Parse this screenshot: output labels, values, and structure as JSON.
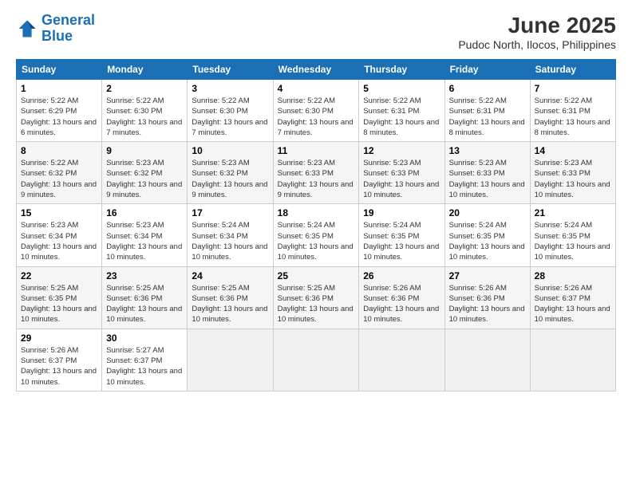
{
  "header": {
    "logo_line1": "General",
    "logo_line2": "Blue",
    "title": "June 2025",
    "subtitle": "Pudoc North, Ilocos, Philippines"
  },
  "weekdays": [
    "Sunday",
    "Monday",
    "Tuesday",
    "Wednesday",
    "Thursday",
    "Friday",
    "Saturday"
  ],
  "weeks": [
    [
      {
        "day": "1",
        "sunrise": "5:22 AM",
        "sunset": "6:29 PM",
        "daylight": "13 hours and 6 minutes."
      },
      {
        "day": "2",
        "sunrise": "5:22 AM",
        "sunset": "6:30 PM",
        "daylight": "13 hours and 7 minutes."
      },
      {
        "day": "3",
        "sunrise": "5:22 AM",
        "sunset": "6:30 PM",
        "daylight": "13 hours and 7 minutes."
      },
      {
        "day": "4",
        "sunrise": "5:22 AM",
        "sunset": "6:30 PM",
        "daylight": "13 hours and 7 minutes."
      },
      {
        "day": "5",
        "sunrise": "5:22 AM",
        "sunset": "6:31 PM",
        "daylight": "13 hours and 8 minutes."
      },
      {
        "day": "6",
        "sunrise": "5:22 AM",
        "sunset": "6:31 PM",
        "daylight": "13 hours and 8 minutes."
      },
      {
        "day": "7",
        "sunrise": "5:22 AM",
        "sunset": "6:31 PM",
        "daylight": "13 hours and 8 minutes."
      }
    ],
    [
      {
        "day": "8",
        "sunrise": "5:22 AM",
        "sunset": "6:32 PM",
        "daylight": "13 hours and 9 minutes."
      },
      {
        "day": "9",
        "sunrise": "5:23 AM",
        "sunset": "6:32 PM",
        "daylight": "13 hours and 9 minutes."
      },
      {
        "day": "10",
        "sunrise": "5:23 AM",
        "sunset": "6:32 PM",
        "daylight": "13 hours and 9 minutes."
      },
      {
        "day": "11",
        "sunrise": "5:23 AM",
        "sunset": "6:33 PM",
        "daylight": "13 hours and 9 minutes."
      },
      {
        "day": "12",
        "sunrise": "5:23 AM",
        "sunset": "6:33 PM",
        "daylight": "13 hours and 10 minutes."
      },
      {
        "day": "13",
        "sunrise": "5:23 AM",
        "sunset": "6:33 PM",
        "daylight": "13 hours and 10 minutes."
      },
      {
        "day": "14",
        "sunrise": "5:23 AM",
        "sunset": "6:33 PM",
        "daylight": "13 hours and 10 minutes."
      }
    ],
    [
      {
        "day": "15",
        "sunrise": "5:23 AM",
        "sunset": "6:34 PM",
        "daylight": "13 hours and 10 minutes."
      },
      {
        "day": "16",
        "sunrise": "5:23 AM",
        "sunset": "6:34 PM",
        "daylight": "13 hours and 10 minutes."
      },
      {
        "day": "17",
        "sunrise": "5:24 AM",
        "sunset": "6:34 PM",
        "daylight": "13 hours and 10 minutes."
      },
      {
        "day": "18",
        "sunrise": "5:24 AM",
        "sunset": "6:35 PM",
        "daylight": "13 hours and 10 minutes."
      },
      {
        "day": "19",
        "sunrise": "5:24 AM",
        "sunset": "6:35 PM",
        "daylight": "13 hours and 10 minutes."
      },
      {
        "day": "20",
        "sunrise": "5:24 AM",
        "sunset": "6:35 PM",
        "daylight": "13 hours and 10 minutes."
      },
      {
        "day": "21",
        "sunrise": "5:24 AM",
        "sunset": "6:35 PM",
        "daylight": "13 hours and 10 minutes."
      }
    ],
    [
      {
        "day": "22",
        "sunrise": "5:25 AM",
        "sunset": "6:35 PM",
        "daylight": "13 hours and 10 minutes."
      },
      {
        "day": "23",
        "sunrise": "5:25 AM",
        "sunset": "6:36 PM",
        "daylight": "13 hours and 10 minutes."
      },
      {
        "day": "24",
        "sunrise": "5:25 AM",
        "sunset": "6:36 PM",
        "daylight": "13 hours and 10 minutes."
      },
      {
        "day": "25",
        "sunrise": "5:25 AM",
        "sunset": "6:36 PM",
        "daylight": "13 hours and 10 minutes."
      },
      {
        "day": "26",
        "sunrise": "5:26 AM",
        "sunset": "6:36 PM",
        "daylight": "13 hours and 10 minutes."
      },
      {
        "day": "27",
        "sunrise": "5:26 AM",
        "sunset": "6:36 PM",
        "daylight": "13 hours and 10 minutes."
      },
      {
        "day": "28",
        "sunrise": "5:26 AM",
        "sunset": "6:37 PM",
        "daylight": "13 hours and 10 minutes."
      }
    ],
    [
      {
        "day": "29",
        "sunrise": "5:26 AM",
        "sunset": "6:37 PM",
        "daylight": "13 hours and 10 minutes."
      },
      {
        "day": "30",
        "sunrise": "5:27 AM",
        "sunset": "6:37 PM",
        "daylight": "13 hours and 10 minutes."
      },
      null,
      null,
      null,
      null,
      null
    ]
  ]
}
